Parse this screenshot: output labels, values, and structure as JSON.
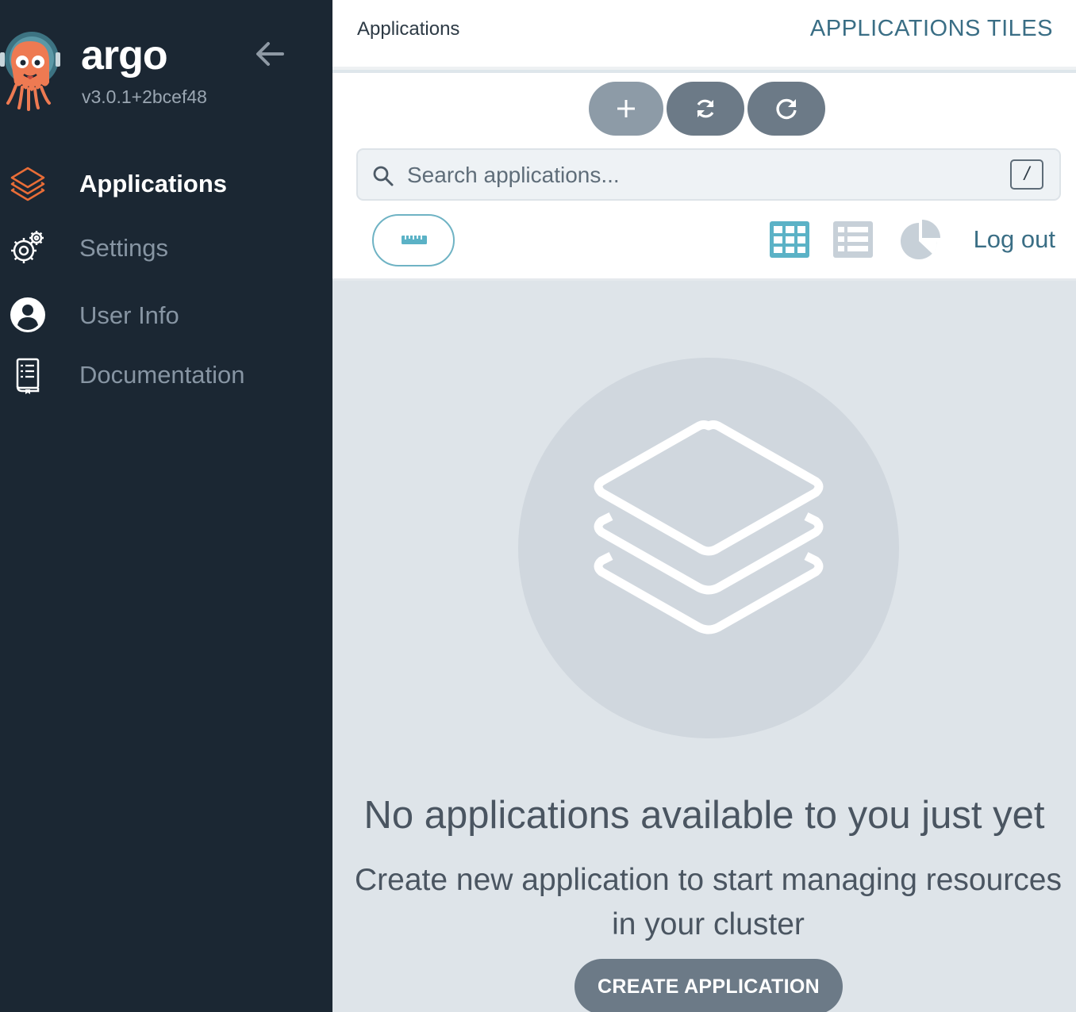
{
  "sidebar": {
    "brand": "argo",
    "version": "v3.0.1+2bcef48",
    "items": [
      {
        "label": "Applications",
        "icon": "stack-icon",
        "active": true
      },
      {
        "label": "Settings",
        "icon": "gears-icon",
        "active": false
      },
      {
        "label": "User Info",
        "icon": "user-circle-icon",
        "active": false
      },
      {
        "label": "Documentation",
        "icon": "book-icon",
        "active": false
      }
    ]
  },
  "header": {
    "breadcrumb": "Applications",
    "title": "APPLICATIONS TILES"
  },
  "toolbar": {
    "buttons": [
      {
        "icon": "plus-icon"
      },
      {
        "icon": "sync-icon"
      },
      {
        "icon": "refresh-icon"
      }
    ],
    "search": {
      "placeholder": "Search applications...",
      "value": "",
      "shortcut": "/"
    },
    "filter_icon": "ruler-icon",
    "views": [
      "grid-icon",
      "list-icon",
      "pie-chart-icon"
    ],
    "logout_label": "Log out"
  },
  "empty_state": {
    "icon": "stack-icon",
    "title": "No applications available to you just yet",
    "subtitle": "Create new application to start managing resources in your cluster",
    "button_label": "CREATE APPLICATION"
  },
  "colors": {
    "sidebar_bg": "#1b2733",
    "accent": "#3a6e85",
    "active_icon": "#e96d37",
    "teal": "#5bb2c6",
    "button_gray": "#6c7a87"
  }
}
